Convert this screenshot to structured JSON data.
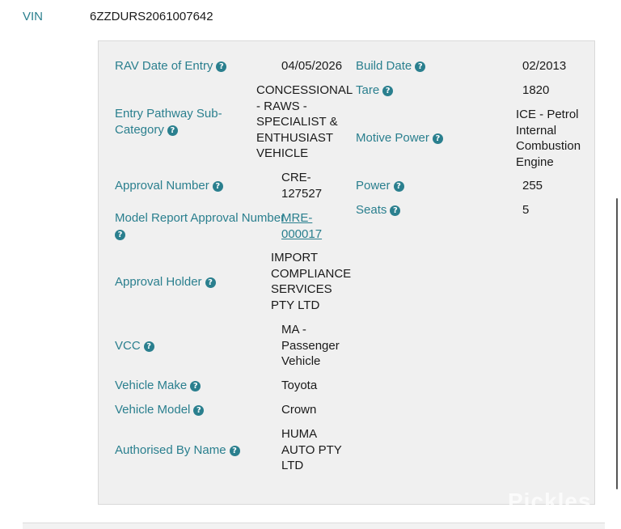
{
  "vin": {
    "label": "VIN",
    "value": "6ZZDURS2061007642"
  },
  "details": {
    "rav_date_label": "RAV Date of Entry",
    "rav_date_value": "04/05/2026",
    "pathway_label_1": "Entry Pathway Sub-",
    "pathway_label_2": "Category",
    "pathway_value": [
      "CONCESSIONAL",
      "- RAWS -",
      "SPECIALIST &",
      "ENTHUSIAST",
      "VEHICLE"
    ],
    "approval_number_label": "Approval Number",
    "approval_number_value": [
      "CRE-",
      "127527"
    ],
    "model_report_label": "Model Report Approval Number",
    "model_report_value": [
      "MRE-",
      "000017"
    ],
    "approval_holder_label": "Approval Holder",
    "approval_holder_value": [
      "IMPORT",
      "COMPLIANCE",
      "SERVICES",
      "PTY LTD"
    ],
    "vcc_label": "VCC",
    "vcc_value": [
      "MA -",
      "Passenger",
      "Vehicle"
    ],
    "make_label": "Vehicle Make",
    "make_value": "Toyota",
    "model_label": "Vehicle Model",
    "model_value": "Crown",
    "authorised_label": "Authorised By Name",
    "authorised_value": [
      "HUMA",
      "AUTO PTY",
      "LTD"
    ],
    "build_date_label": "Build Date",
    "build_date_value": "02/2013",
    "tare_label": "Tare",
    "tare_value": "1820",
    "motive_label": "Motive Power",
    "motive_value": [
      "ICE - Petrol",
      "Internal",
      "Combustion",
      "Engine"
    ],
    "power_label": "Power",
    "power_value": "255",
    "seats_label": "Seats",
    "seats_value": "5"
  },
  "help_glyph": "?",
  "watermark": "Pickles",
  "colors": {
    "accent": "#2a7f8e",
    "panel": "#f0f0f0"
  }
}
